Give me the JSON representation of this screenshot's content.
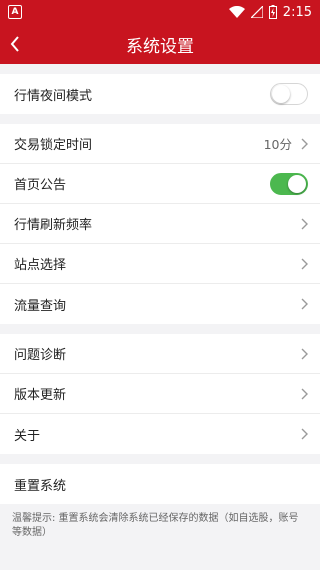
{
  "status_bar": {
    "app_icon_letter": "A",
    "time": "2:15",
    "icons": [
      "wifi-icon",
      "signal-icon",
      "battery-charging-icon"
    ]
  },
  "header": {
    "title": "系统设置",
    "back_icon": "chevron-left-icon"
  },
  "groups": [
    {
      "rows": [
        {
          "label": "行情夜间模式",
          "control": "toggle",
          "toggle_on": false
        }
      ]
    },
    {
      "rows": [
        {
          "label": "交易锁定时间",
          "value": "10分",
          "control": "chevron"
        },
        {
          "label": "首页公告",
          "control": "toggle",
          "toggle_on": true
        },
        {
          "label": "行情刷新频率",
          "control": "chevron"
        },
        {
          "label": "站点选择",
          "control": "chevron"
        },
        {
          "label": "流量查询",
          "control": "chevron"
        }
      ]
    },
    {
      "rows": [
        {
          "label": "问题诊断",
          "control": "chevron"
        },
        {
          "label": "版本更新",
          "control": "chevron"
        },
        {
          "label": "关于",
          "control": "chevron"
        }
      ]
    },
    {
      "rows": [
        {
          "label": "重置系统",
          "control": "none"
        }
      ]
    }
  ],
  "tip": "温馨提示: 重置系统会清除系统已经保存的数据（如自选股，账号等数据）",
  "colors": {
    "brand": "#c8141f",
    "toggle_on": "#4cb84f",
    "background": "#f3f3f5"
  }
}
